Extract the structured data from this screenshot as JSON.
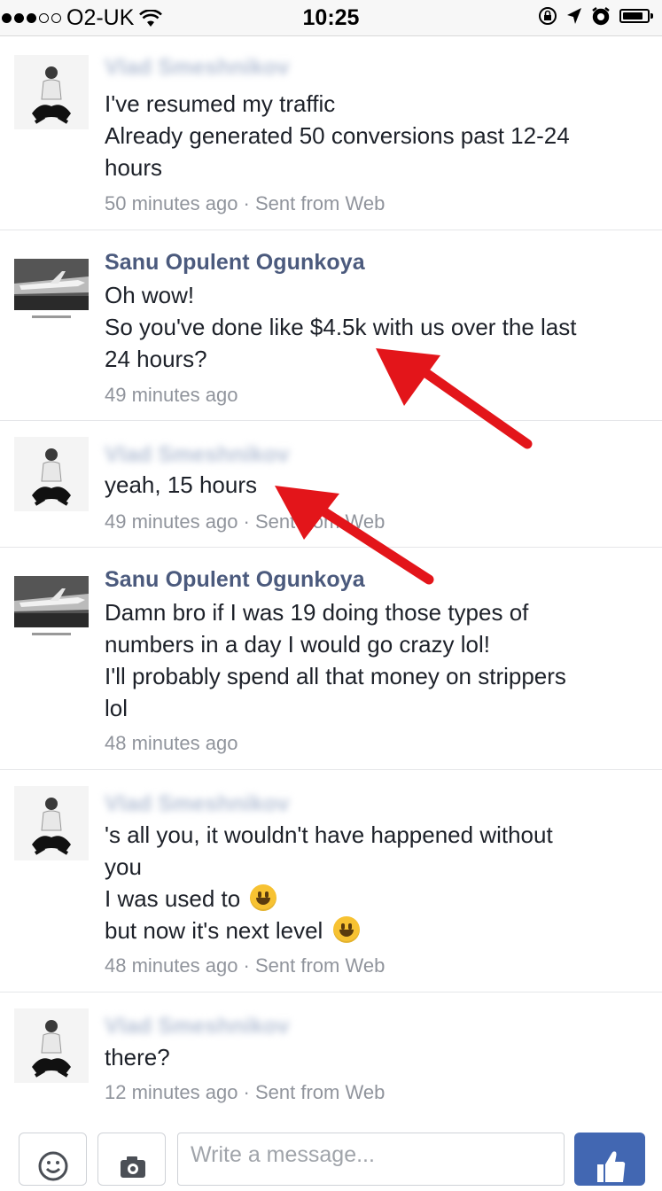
{
  "status_bar": {
    "carrier": "O2-UK",
    "time": "10:25",
    "icons": [
      "signal-dots",
      "wifi-icon",
      "rotation-lock-icon",
      "location-arrow-icon",
      "alarm-icon",
      "battery-icon"
    ]
  },
  "messages": [
    {
      "sender": "Vlad Smeshnikov",
      "sender_blurred": true,
      "avatar": "man-avatar",
      "lines": [
        "I've resumed my traffic",
        "Already generated 50 conversions past 12-24",
        "hours"
      ],
      "meta": "50 minutes ago · Sent from Web"
    },
    {
      "sender": "Sanu Opulent Ogunkoya",
      "sender_blurred": false,
      "avatar": "jet-avatar",
      "lines": [
        "Oh wow!",
        "So you've done like $4.5k with us over the last",
        "24 hours?"
      ],
      "meta": "49 minutes ago"
    },
    {
      "sender": "Vlad Smeshnikov",
      "sender_blurred": true,
      "avatar": "man-avatar",
      "lines": [
        "yeah, 15 hours"
      ],
      "meta": "49 minutes ago · Sent from Web"
    },
    {
      "sender": "Sanu Opulent Ogunkoya",
      "sender_blurred": false,
      "avatar": "jet-avatar",
      "lines": [
        "Damn bro if I was 19 doing those types of",
        "numbers in a day I would go crazy lol!",
        "I'll probably spend all that money on strippers",
        "lol"
      ],
      "meta": "48 minutes ago"
    },
    {
      "sender": "Vlad Smeshnikov",
      "sender_blurred": true,
      "avatar": "man-avatar",
      "lines": [
        "'s all you, it wouldn't have happened without",
        "you",
        "I was used to",
        "but now it's next level"
      ],
      "meta": "48 minutes ago · Sent from Web"
    },
    {
      "sender": "Vlad Smeshnikov",
      "sender_blurred": true,
      "avatar": "man-avatar",
      "lines": [
        "there?"
      ],
      "meta": "12 minutes ago · Sent from Web"
    }
  ],
  "composer": {
    "placeholder": "Write a message...",
    "buttons": [
      "emoji-button",
      "camera-button",
      "like-button"
    ]
  },
  "colors": {
    "sender_name": "#4b5a7d",
    "meta_text": "#90949c",
    "annotation_arrow": "#e3151a",
    "like_button": "#4267b2"
  }
}
